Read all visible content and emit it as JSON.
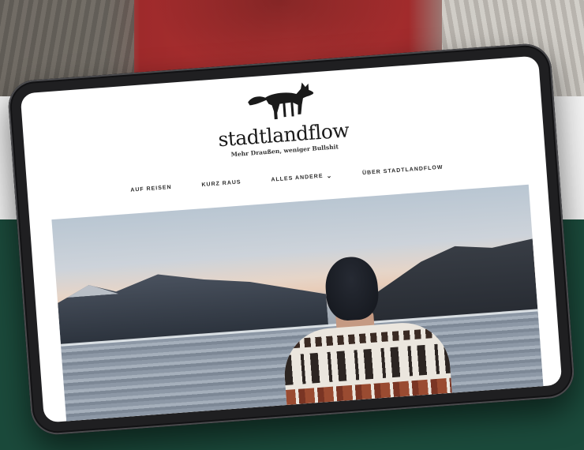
{
  "site": {
    "brand": "stadtlandflow",
    "tagline": "Mehr Draußen, weniger Bullshit"
  },
  "nav": {
    "items": [
      {
        "label": "AUF REISEN"
      },
      {
        "label": "KURZ RAUS"
      },
      {
        "label": "ALLES ANDERE",
        "icon": "chevron-down-icon",
        "chevron": "⌄"
      },
      {
        "label": "ÜBER STADTLANDFLOW"
      }
    ]
  },
  "hero": {
    "icon": "landscape-photo",
    "scene": "person-at-lake"
  },
  "colors": {
    "background_green": "#1b4a3b",
    "tablet_frame": "#1f1f21",
    "screen": "#ffffff",
    "text": "#1a1a1a"
  }
}
